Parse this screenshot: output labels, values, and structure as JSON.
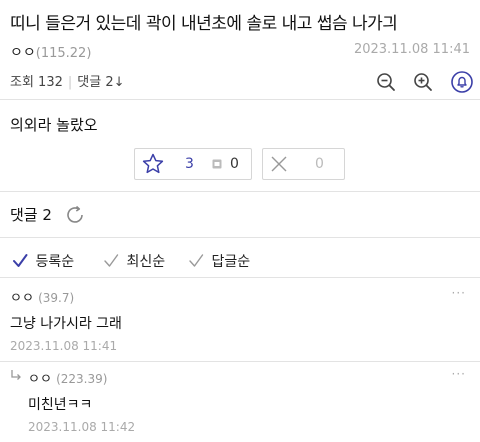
{
  "post": {
    "title": "띠니 들은거 있는데 곽이 내년초에 솔로 내고 썹슴 나가긔",
    "author": "ㅇㅇ",
    "author_ip": "(115.22)",
    "date": "2023.11.08 11:41",
    "views_label": "조회 132",
    "comments_label": "댓글 2↓",
    "body": "의외라 놀랐오"
  },
  "votes": {
    "up_count": "3",
    "fixed_count": "0",
    "down_count": "0"
  },
  "comments_section": {
    "header": "댓글 2"
  },
  "sort_options": [
    {
      "label": "등록순",
      "active": true
    },
    {
      "label": "최신순",
      "active": false
    },
    {
      "label": "답글순",
      "active": false
    }
  ],
  "comments": [
    {
      "author": "ㅇㅇ",
      "ip": "(39.7)",
      "text": "그냥 나가시라 그래",
      "date": "2023.11.08 11:41",
      "more": "···"
    },
    {
      "author": "ㅇㅇ",
      "ip": "(223.39)",
      "text": "미친년ㅋㅋ",
      "date": "2023.11.08 11:42",
      "more": "···",
      "reply": true
    }
  ],
  "colors": {
    "accent": "#3b3fa8",
    "muted": "#aaaaaa"
  },
  "icons": [
    "zoom-out-icon",
    "zoom-in-icon",
    "bell-icon",
    "star-icon",
    "fixed-nick-icon",
    "x-icon",
    "refresh-icon",
    "check-icon",
    "reply-arrow-icon"
  ]
}
